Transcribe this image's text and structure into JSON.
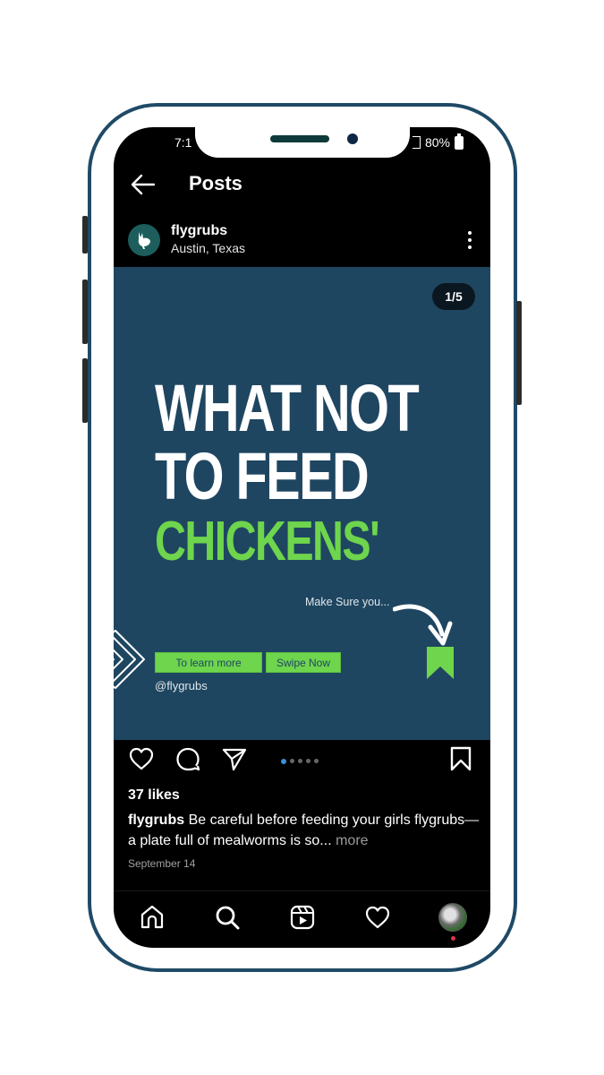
{
  "status_bar": {
    "time": "7:1",
    "battery": "80%"
  },
  "header": {
    "title": "Posts"
  },
  "post": {
    "username": "flygrubs",
    "location": "Austin, Texas",
    "carousel_counter": "1/5",
    "carousel": {
      "current": 1,
      "total": 5
    },
    "image": {
      "headline_line1": "WHAT NOT",
      "headline_line2": "TO FEED",
      "headline_line3": "CHICKENS'",
      "make_sure": "Make Sure you...",
      "cta_learn": "To learn more",
      "cta_swipe": "Swipe Now",
      "handle": "@flygrubs"
    },
    "likes": "37 likes",
    "caption_user": "flygrubs",
    "caption_text": " Be careful before feeding your girls flygrubs—a plate full of mealworms is so...",
    "caption_more": " more",
    "date": "September 14"
  },
  "colors": {
    "frame": "#1f4a66",
    "post_bg": "#1f4661",
    "accent_green": "#6ed54d",
    "carousel_active": "#3b8fd6",
    "notification_dot": "#e0344e"
  },
  "nav": {
    "items": [
      {
        "icon": "home-icon"
      },
      {
        "icon": "search-icon"
      },
      {
        "icon": "reels-icon"
      },
      {
        "icon": "heart-icon"
      },
      {
        "icon": "profile-avatar"
      }
    ]
  }
}
